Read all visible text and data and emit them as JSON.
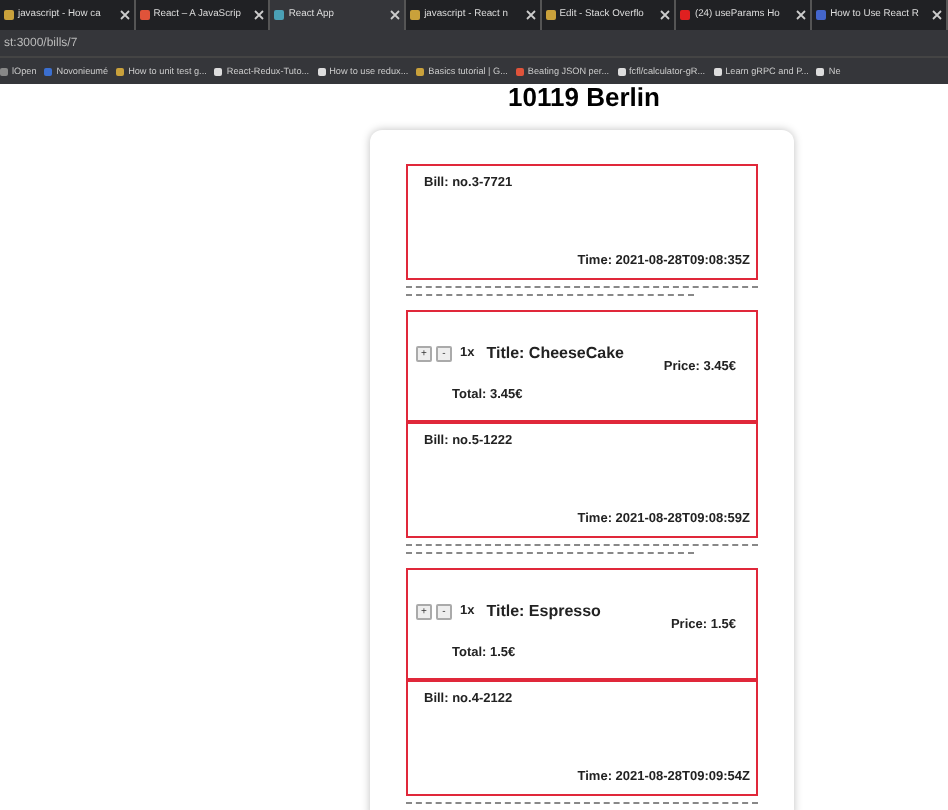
{
  "browser": {
    "tabs": [
      {
        "title": "javascript - How ca",
        "selected": false
      },
      {
        "title": "React – A JavaScrip",
        "selected": false
      },
      {
        "title": "React App",
        "selected": true
      },
      {
        "title": "javascript - React n",
        "selected": false
      },
      {
        "title": "Edit - Stack Overflo",
        "selected": false
      },
      {
        "title": "(24) useParams Ho",
        "selected": false
      },
      {
        "title": "How to Use React R",
        "selected": false
      }
    ],
    "address": "st:3000/bills/7",
    "bookmarks": [
      "lOpen",
      "Novonieumé",
      "How to unit test g...",
      "React-Redux-Tuto...",
      "How to use redux...",
      "Basics tutorial | G...",
      "Beating JSON per...",
      "fcfl/calculator-gR...",
      "Learn gRPC and P...",
      "Ne"
    ]
  },
  "page": {
    "title": "10119 Berlin",
    "entries": [
      {
        "kind": "bill",
        "bill": "Bill: no.3-7721",
        "time": "Time: 2021-08-28T09:08:35Z"
      },
      {
        "kind": "item",
        "plus": "+",
        "minus": "-",
        "quantity": "1x",
        "title": "Title: CheeseCake",
        "price": "Price: 3.45€",
        "total": "Total: 3.45€"
      },
      {
        "kind": "bill",
        "bill": "Bill: no.5-1222",
        "time": "Time: 2021-08-28T09:08:59Z"
      },
      {
        "kind": "item",
        "plus": "+",
        "minus": "-",
        "quantity": "1x",
        "title": "Title: Espresso",
        "price": "Price: 1.5€",
        "total": "Total: 1.5€"
      },
      {
        "kind": "bill",
        "bill": "Bill: no.4-2122",
        "time": "Time: 2021-08-28T09:09:54Z"
      }
    ]
  }
}
